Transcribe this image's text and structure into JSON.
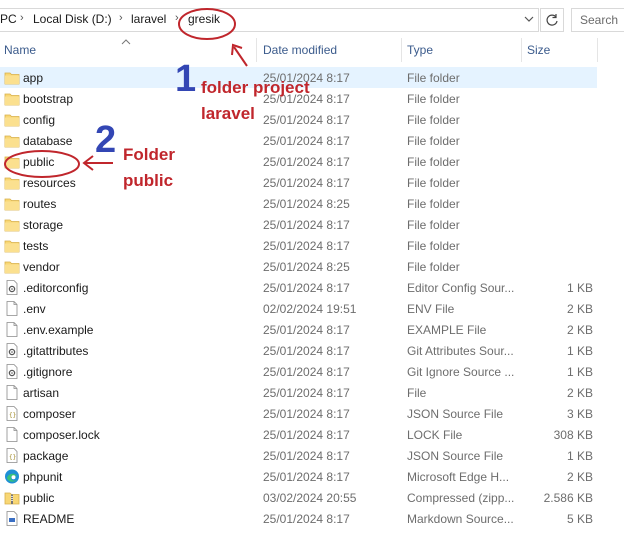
{
  "address_bar": {
    "crumbs": [
      "PC",
      "Local Disk (D:)",
      "laravel",
      "gresik"
    ],
    "search_placeholder": "Search"
  },
  "columns": {
    "name": "Name",
    "date": "Date modified",
    "type": "Type",
    "size": "Size"
  },
  "files": [
    {
      "name": "app",
      "date": "25/01/2024 8:17",
      "type": "File folder",
      "size": "",
      "icon": "folder-icon",
      "selected": true
    },
    {
      "name": "bootstrap",
      "date": "25/01/2024 8:17",
      "type": "File folder",
      "size": "",
      "icon": "folder-icon"
    },
    {
      "name": "config",
      "date": "25/01/2024 8:17",
      "type": "File folder",
      "size": "",
      "icon": "folder-icon"
    },
    {
      "name": "database",
      "date": "25/01/2024 8:17",
      "type": "File folder",
      "size": "",
      "icon": "folder-icon"
    },
    {
      "name": "public",
      "date": "25/01/2024 8:17",
      "type": "File folder",
      "size": "",
      "icon": "folder-icon"
    },
    {
      "name": "resources",
      "date": "25/01/2024 8:17",
      "type": "File folder",
      "size": "",
      "icon": "folder-icon"
    },
    {
      "name": "routes",
      "date": "25/01/2024 8:25",
      "type": "File folder",
      "size": "",
      "icon": "folder-icon"
    },
    {
      "name": "storage",
      "date": "25/01/2024 8:17",
      "type": "File folder",
      "size": "",
      "icon": "folder-icon"
    },
    {
      "name": "tests",
      "date": "25/01/2024 8:17",
      "type": "File folder",
      "size": "",
      "icon": "folder-icon"
    },
    {
      "name": "vendor",
      "date": "25/01/2024 8:25",
      "type": "File folder",
      "size": "",
      "icon": "folder-icon"
    },
    {
      "name": ".editorconfig",
      "date": "25/01/2024 8:17",
      "type": "Editor Config Sour...",
      "size": "1 KB",
      "icon": "gear-file-icon"
    },
    {
      "name": ".env",
      "date": "02/02/2024 19:51",
      "type": "ENV File",
      "size": "2 KB",
      "icon": "file-icon"
    },
    {
      "name": ".env.example",
      "date": "25/01/2024 8:17",
      "type": "EXAMPLE File",
      "size": "2 KB",
      "icon": "file-icon"
    },
    {
      "name": ".gitattributes",
      "date": "25/01/2024 8:17",
      "type": "Git Attributes Sour...",
      "size": "1 KB",
      "icon": "gear-file-icon"
    },
    {
      "name": ".gitignore",
      "date": "25/01/2024 8:17",
      "type": "Git Ignore Source ...",
      "size": "1 KB",
      "icon": "gear-file-icon"
    },
    {
      "name": "artisan",
      "date": "25/01/2024 8:17",
      "type": "File",
      "size": "2 KB",
      "icon": "file-icon"
    },
    {
      "name": "composer",
      "date": "25/01/2024 8:17",
      "type": "JSON Source File",
      "size": "3 KB",
      "icon": "json-file-icon"
    },
    {
      "name": "composer.lock",
      "date": "25/01/2024 8:17",
      "type": "LOCK File",
      "size": "308 KB",
      "icon": "file-icon"
    },
    {
      "name": "package",
      "date": "25/01/2024 8:17",
      "type": "JSON Source File",
      "size": "1 KB",
      "icon": "json-file-icon"
    },
    {
      "name": "phpunit",
      "date": "25/01/2024 8:17",
      "type": "Microsoft Edge H...",
      "size": "2 KB",
      "icon": "edge-icon"
    },
    {
      "name": "public",
      "date": "03/02/2024 20:55",
      "type": "Compressed (zipp...",
      "size": "2.586 KB",
      "icon": "zip-icon"
    },
    {
      "name": "README",
      "date": "25/01/2024 8:17",
      "type": "Markdown Source...",
      "size": "5 KB",
      "icon": "markdown-file-icon"
    }
  ],
  "annotations": {
    "step1_number": "1",
    "step1_text": [
      "folder project",
      "laravel"
    ],
    "step2_number": "2",
    "step2_text": [
      "Folder",
      "public"
    ],
    "color": "#c0262c",
    "number_color": "#3346b4"
  }
}
